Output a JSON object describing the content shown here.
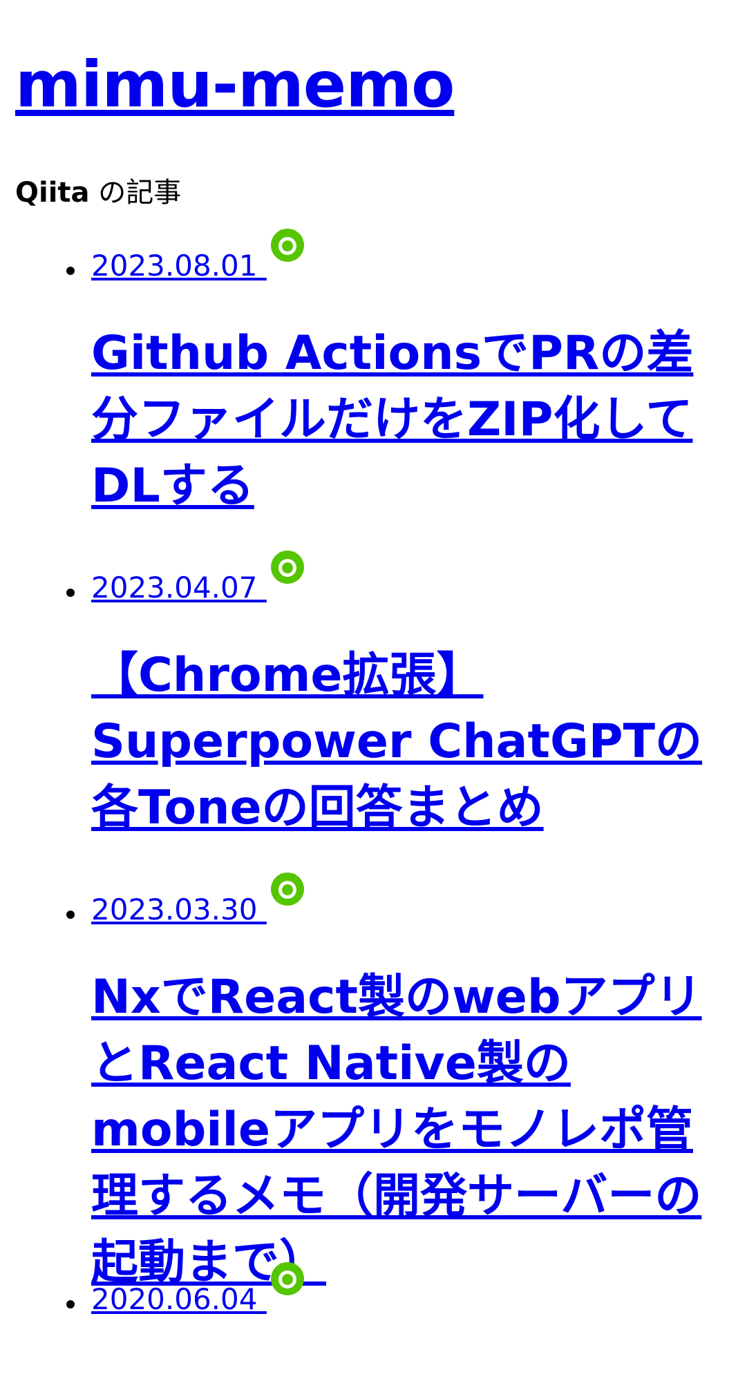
{
  "site": {
    "title": "mimu-memo"
  },
  "section": {
    "brand": "Qiita",
    "suffix": " の記事"
  },
  "posts": [
    {
      "date": "2023.08.01 ",
      "title": "Github ActionsでPRの差分ファイルだけをZIP化してDLする",
      "icon": "qiita-icon"
    },
    {
      "date": "2023.04.07 ",
      "title": "【Chrome拡張】Superpower ChatGPTの各Toneの回答まとめ",
      "icon": "qiita-icon"
    },
    {
      "date": "2023.03.30 ",
      "title": "NxでReact製のwebアプリとReact Native製のmobileアプリをモノレポ管理するメモ（開発サーバーの起動まで）",
      "icon": "qiita-icon"
    },
    {
      "date": "2020.06.04 ",
      "icon": "qiita-icon"
    }
  ],
  "colors": {
    "link": "#0000ee",
    "qiita_green": "#55c500",
    "text": "#000000",
    "background": "#ffffff"
  }
}
